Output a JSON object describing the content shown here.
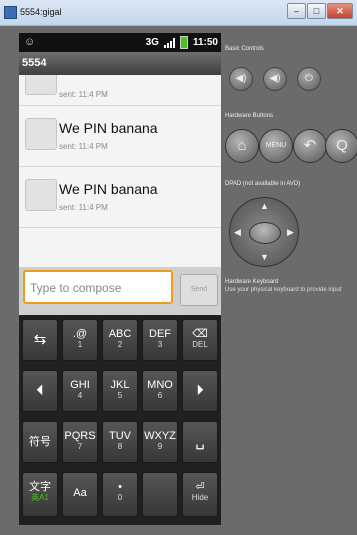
{
  "window": {
    "title": "5554:gigal",
    "controls": [
      "–",
      "□",
      "✕"
    ]
  },
  "phone": {
    "status_bar": {
      "time": "11:50",
      "network": "3G",
      "left_icon": "android-notification-icon",
      "signal_icon": "signal-bars-icon",
      "battery_icon": "battery-icon"
    },
    "app_title": "5554",
    "messages": [
      {
        "body": "",
        "time": "sent: 11:4 PM"
      },
      {
        "body": "We PIN banana",
        "time": "sent: 11:4 PM"
      },
      {
        "body": "We PIN banana",
        "time": "sent: 11:4 PM"
      }
    ],
    "compose": {
      "placeholder": "Type to compose",
      "send_label": "Send"
    },
    "keyboard": {
      "rows": [
        [
          {
            "main": "⇆",
            "sub": ""
          },
          {
            "main": ".@",
            "sub": "1"
          },
          {
            "main": "ABC",
            "sub": "2"
          },
          {
            "main": "DEF",
            "sub": "3"
          },
          {
            "main": "⌫",
            "sub": "DEL"
          }
        ],
        [
          {
            "main": "⏴",
            "sub": ""
          },
          {
            "main": "GHI",
            "sub": "4"
          },
          {
            "main": "JKL",
            "sub": "5"
          },
          {
            "main": "MNO",
            "sub": "6"
          },
          {
            "main": "⏵",
            "sub": ""
          }
        ],
        [
          {
            "main": "符号",
            "sub": ""
          },
          {
            "main": "PQRS",
            "sub": "7"
          },
          {
            "main": "TUV",
            "sub": "8"
          },
          {
            "main": "WXYZ",
            "sub": "9"
          },
          {
            "main": "␣",
            "sub": ""
          }
        ],
        [
          {
            "main": "文字",
            "sub": "英A1"
          },
          {
            "main": "Aa",
            "sub": ""
          },
          {
            "main": "•",
            "sub": "0"
          },
          {
            "main": "",
            "sub": ""
          },
          {
            "main": "⏎",
            "sub": "Hide"
          }
        ]
      ]
    }
  },
  "panel": {
    "basic_controls_label": "Basic Controls",
    "basic_buttons": [
      "◀)",
      "◀)",
      "⏻"
    ],
    "hardware_buttons_label": "Hardware Buttons",
    "hardware_buttons": [
      "⌂",
      "MENU",
      "↶",
      "Q"
    ],
    "dpad_label": "DPAD (not available in AVD)",
    "keyboard_label": "Hardware Keyboard",
    "keyboard_note": "Use your physical keyboard to provide input"
  },
  "colors": {
    "compose_focus": "#f39a18",
    "battery": "#4bc51e",
    "background": "#6b6b6b"
  }
}
